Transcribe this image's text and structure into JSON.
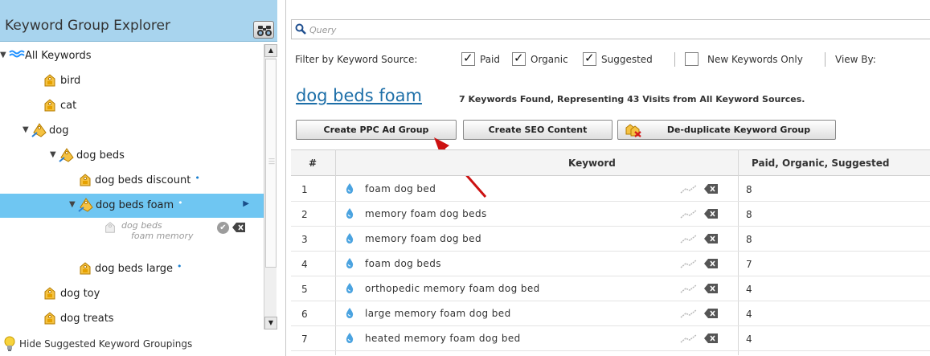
{
  "left_panel": {
    "title": "Keyword Group Explorer",
    "search_button_icon": "binoculars-icon",
    "tree": [
      {
        "label": "All Keywords",
        "level": 0,
        "expanded": true,
        "icon": "waves-icon"
      },
      {
        "label": "bird",
        "level": 1,
        "icon": "tag-icon"
      },
      {
        "label": "cat",
        "level": 1,
        "icon": "tag-icon"
      },
      {
        "label": "dog",
        "level": 1,
        "expanded": true,
        "icon": "tag-open-icon"
      },
      {
        "label": "dog beds",
        "level": 2,
        "expanded": true,
        "icon": "tag-open-icon"
      },
      {
        "label": "dog beds discount",
        "level": 3,
        "icon": "tag-icon",
        "new": true
      },
      {
        "label": "dog beds foam",
        "level": 3,
        "expanded": true,
        "icon": "tag-open-icon",
        "new": true,
        "selected": true
      },
      {
        "label_line1": "dog beds",
        "label_line2": "foam memory",
        "level": 4,
        "icon": "tag-faded-icon",
        "suggested": true
      },
      {
        "label": "dog beds large",
        "level": 3,
        "icon": "tag-icon",
        "new": true
      },
      {
        "label": "dog toy",
        "level": 1,
        "icon": "tag-icon"
      },
      {
        "label": "dog treats",
        "level": 1,
        "icon": "tag-icon"
      }
    ],
    "new_marker": "•",
    "hide_suggested_label": "Hide Suggested Keyword Groupings",
    "hide_suggested_icon": "lightbulb-icon"
  },
  "query": {
    "placeholder": "Query",
    "icon": "search-icon"
  },
  "filter": {
    "label": "Filter by Keyword Source:",
    "options": [
      {
        "label": "Paid",
        "checked": true
      },
      {
        "label": "Organic",
        "checked": true
      },
      {
        "label": "Suggested",
        "checked": true
      }
    ],
    "new_only_label": "New Keywords Only",
    "new_only_checked": false,
    "view_by_label": "View By:"
  },
  "group": {
    "title": "dog beds foam",
    "found_text": "7 Keywords Found, Representing 43 Visits from All Keyword Sources."
  },
  "buttons": {
    "ppc": "Create PPC Ad Group",
    "seo": "Create SEO Content",
    "dedupe": "De-duplicate Keyword Group",
    "dedupe_icon": "tags-x-icon"
  },
  "table": {
    "headers": {
      "num": "#",
      "keyword": "Keyword",
      "sources": "Paid, Organic, Suggested"
    },
    "rows": [
      {
        "num": "1",
        "keyword": "foam dog bed",
        "count": "8"
      },
      {
        "num": "2",
        "keyword": "memory foam dog beds",
        "count": "8"
      },
      {
        "num": "3",
        "keyword": "memory foam dog bed",
        "count": "8"
      },
      {
        "num": "4",
        "keyword": "foam dog beds",
        "count": "7"
      },
      {
        "num": "5",
        "keyword": "orthopedic memory foam dog bed",
        "count": "4"
      },
      {
        "num": "6",
        "keyword": "large memory foam dog bed",
        "count": "4"
      },
      {
        "num": "7",
        "keyword": "heated memory foam dog bed",
        "count": "4"
      }
    ],
    "row_icons": {
      "drop": "droplet-icon",
      "trend": "trend-icon",
      "delete": "delete-icon"
    }
  },
  "annotation": {
    "arrow_color": "#cc1111"
  },
  "colors": {
    "header_bg": "#a8d4ee",
    "selected_bg": "#6fc6f2",
    "link": "#1d6fa8"
  }
}
